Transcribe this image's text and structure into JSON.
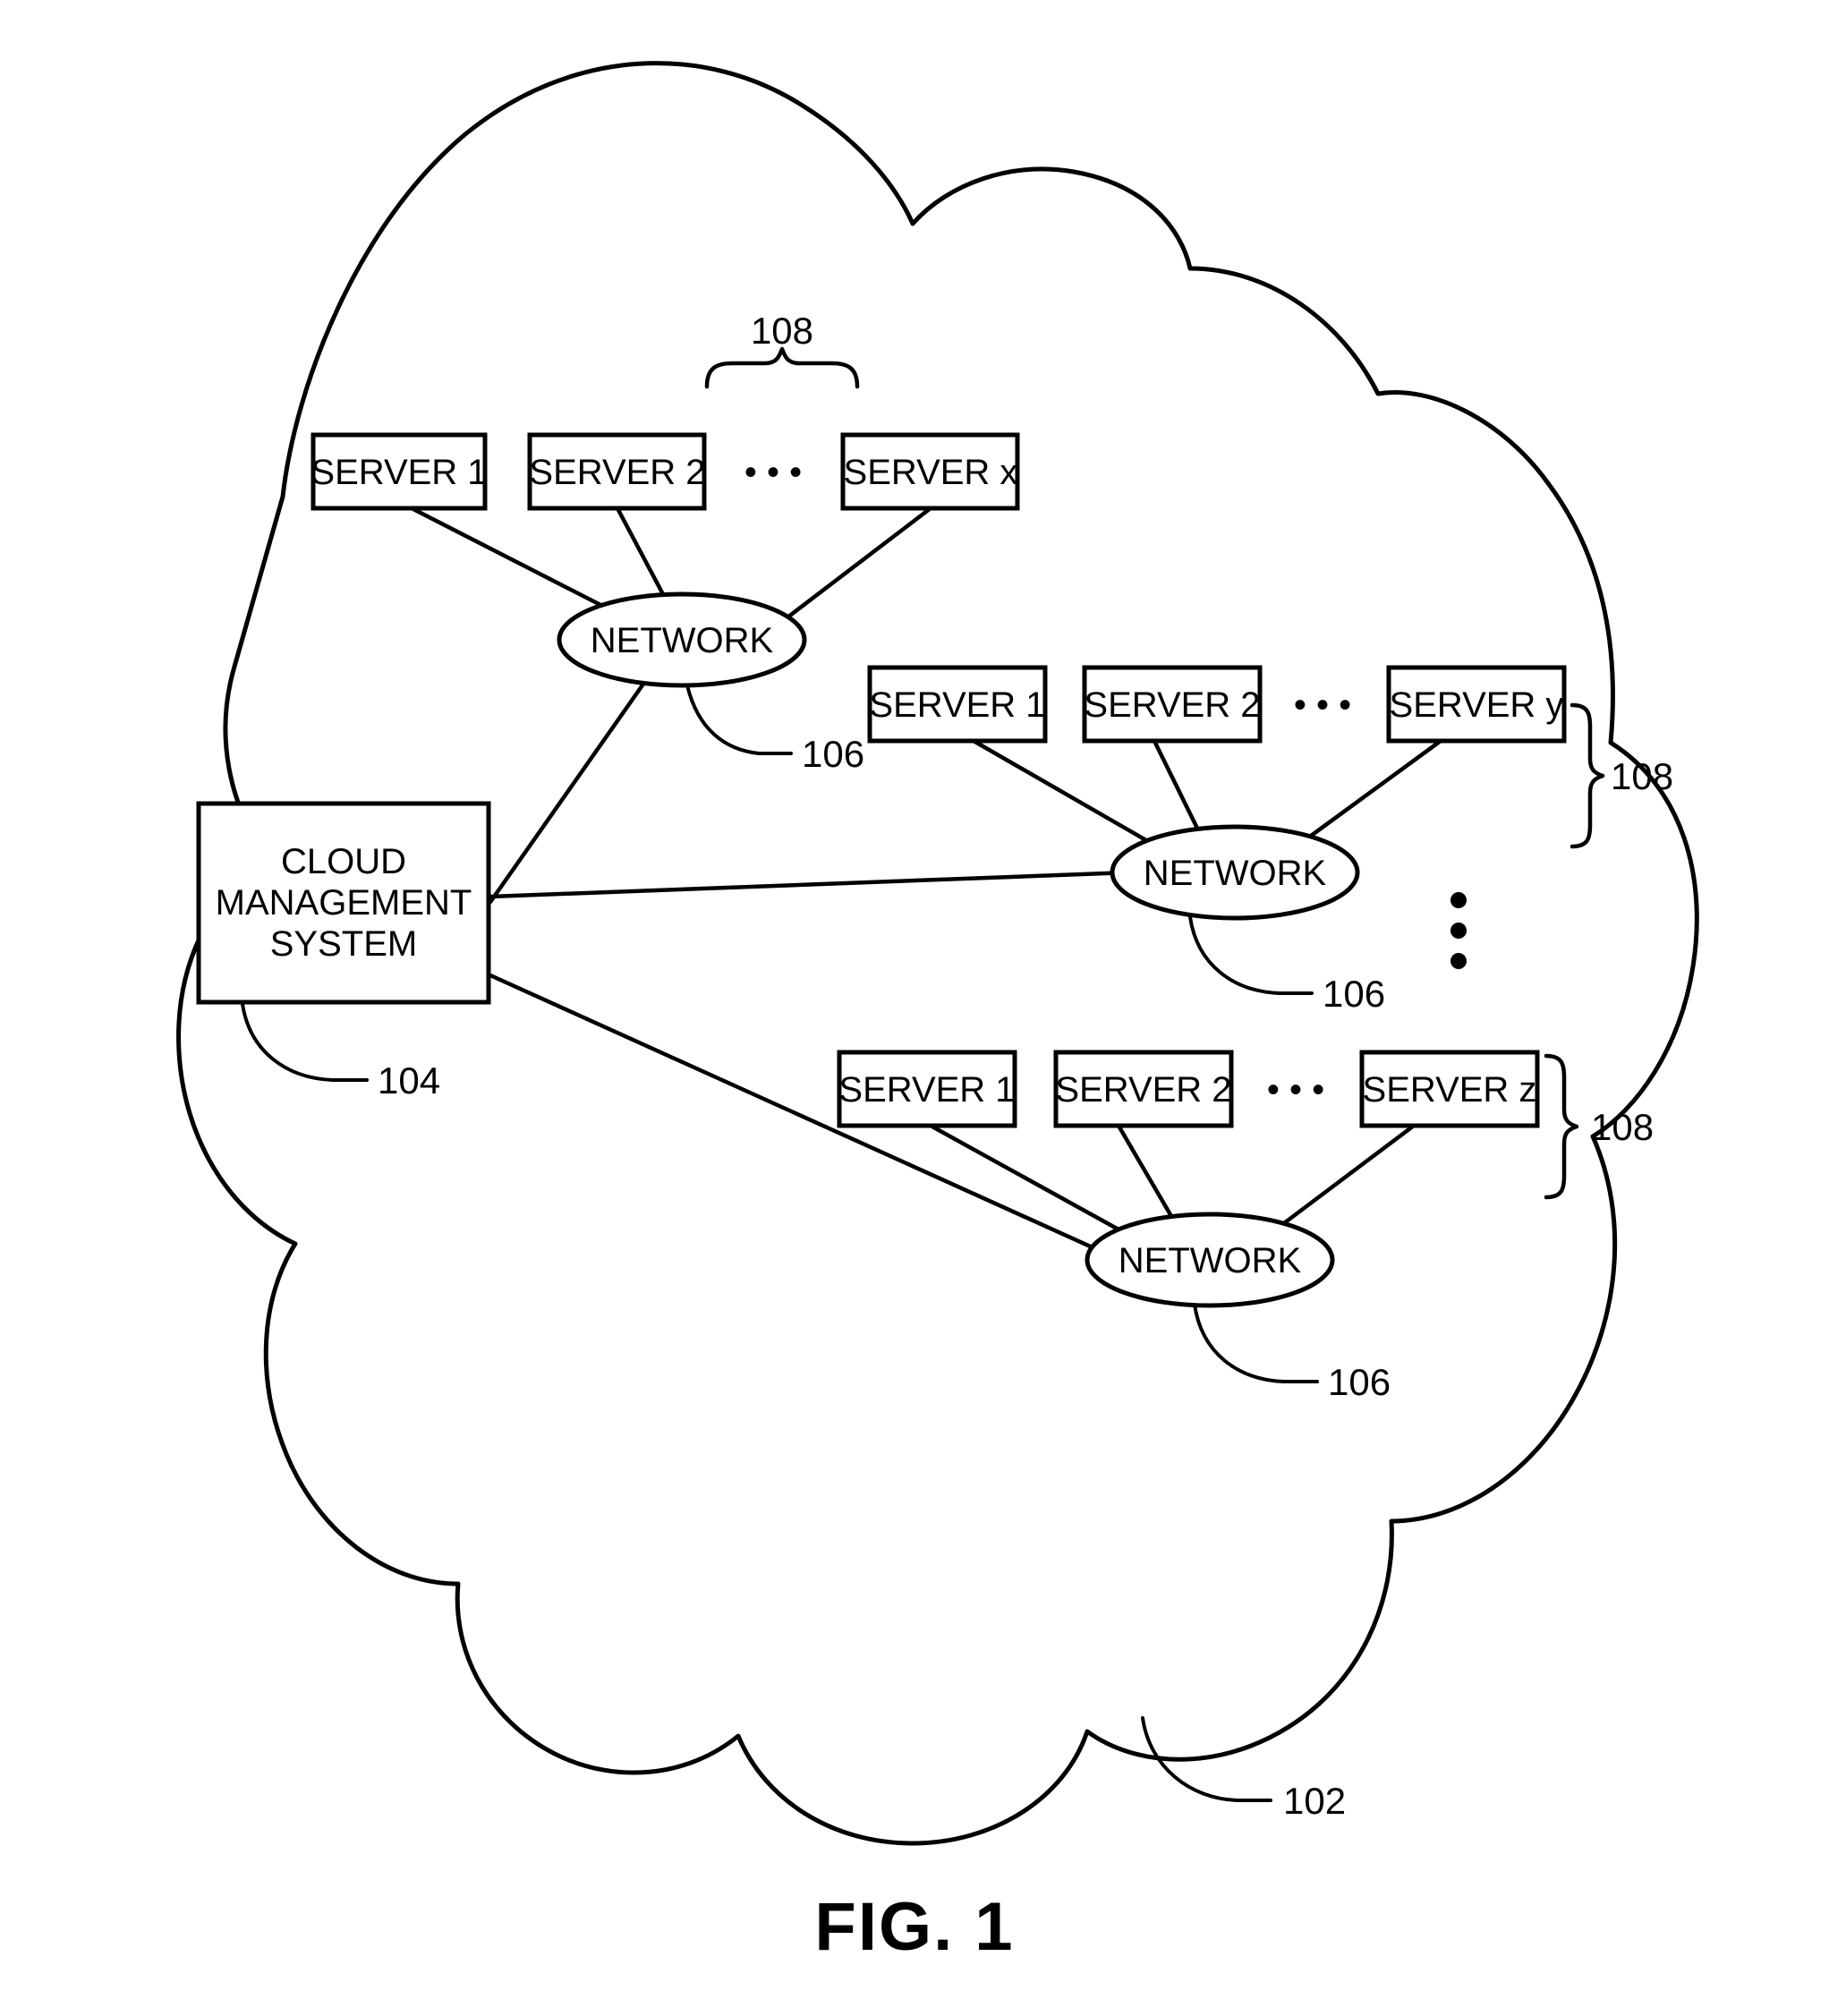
{
  "figure": {
    "caption": "FIG. 1",
    "cloud_label": "102",
    "accent_color": "#000000",
    "background_color": "#ffffff"
  },
  "cloud_management_system": {
    "line1": "CLOUD",
    "line2": "MANAGEMENT",
    "line3": "SYSTEM",
    "ref": "104"
  },
  "groups": [
    {
      "id": "group-top",
      "brace_ref": "108",
      "network_label": "NETWORK",
      "network_ref": "106",
      "ellipsis": "• • •",
      "servers": [
        {
          "label": "SERVER 1"
        },
        {
          "label": "SERVER 2"
        },
        {
          "label": "SERVER x"
        }
      ]
    },
    {
      "id": "group-middle",
      "brace_ref": "108",
      "network_label": "NETWORK",
      "network_ref": "106",
      "ellipsis": "• • •",
      "servers": [
        {
          "label": "SERVER 1"
        },
        {
          "label": "SERVER 2"
        },
        {
          "label": "SERVER y"
        }
      ]
    },
    {
      "id": "group-bottom",
      "brace_ref": "108",
      "network_label": "NETWORK",
      "network_ref": "106",
      "ellipsis": "• • •",
      "servers": [
        {
          "label": "SERVER 1"
        },
        {
          "label": "SERVER 2"
        },
        {
          "label": "SERVER z"
        }
      ]
    }
  ],
  "vertical_ellipsis": {
    "name": "more-groups-indicator",
    "dots": 3
  }
}
